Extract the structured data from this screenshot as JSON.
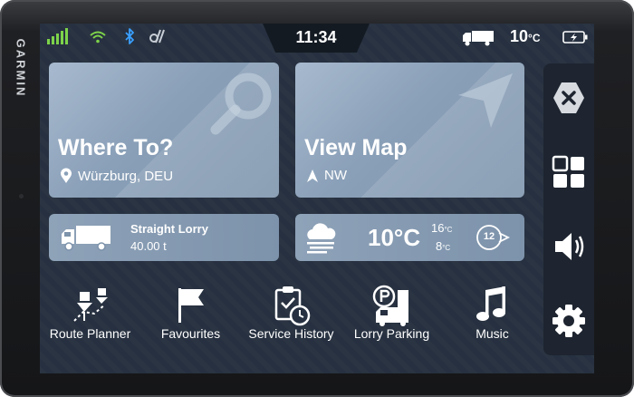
{
  "brand": "GARMIN",
  "status": {
    "time": "11:34",
    "temperature_value": "10",
    "temperature_unit": "°C",
    "icons": [
      "signal-bars-icon",
      "wifi-icon",
      "bluetooth-icon",
      "drive-app-icon",
      "lorry-icon",
      "battery-charging-icon"
    ],
    "colors": {
      "signal": "#7dd34a",
      "wifi": "#7dd34a",
      "bluetooth": "#3aa0ff"
    }
  },
  "tiles": {
    "where_to": {
      "title": "Where To?",
      "subtitle": "Würzburg, DEU"
    },
    "view_map": {
      "title": "View Map",
      "subtitle": "NW"
    },
    "vehicle": {
      "name": "Straight Lorry",
      "weight": "40.00 t"
    },
    "weather": {
      "current": "10°C",
      "high": "16",
      "low": "8",
      "unit": "°C",
      "speed_limit": "12"
    }
  },
  "apps": [
    {
      "label": "Route Planner",
      "icon": "route-planner-icon"
    },
    {
      "label": "Favourites",
      "icon": "flag-icon"
    },
    {
      "label": "Service History",
      "icon": "service-history-icon"
    },
    {
      "label": "Lorry Parking",
      "icon": "lorry-parking-icon"
    },
    {
      "label": "Music",
      "icon": "music-note-icon"
    }
  ],
  "sidebar": [
    "close-icon",
    "apps-grid-icon",
    "volume-icon",
    "settings-icon"
  ]
}
